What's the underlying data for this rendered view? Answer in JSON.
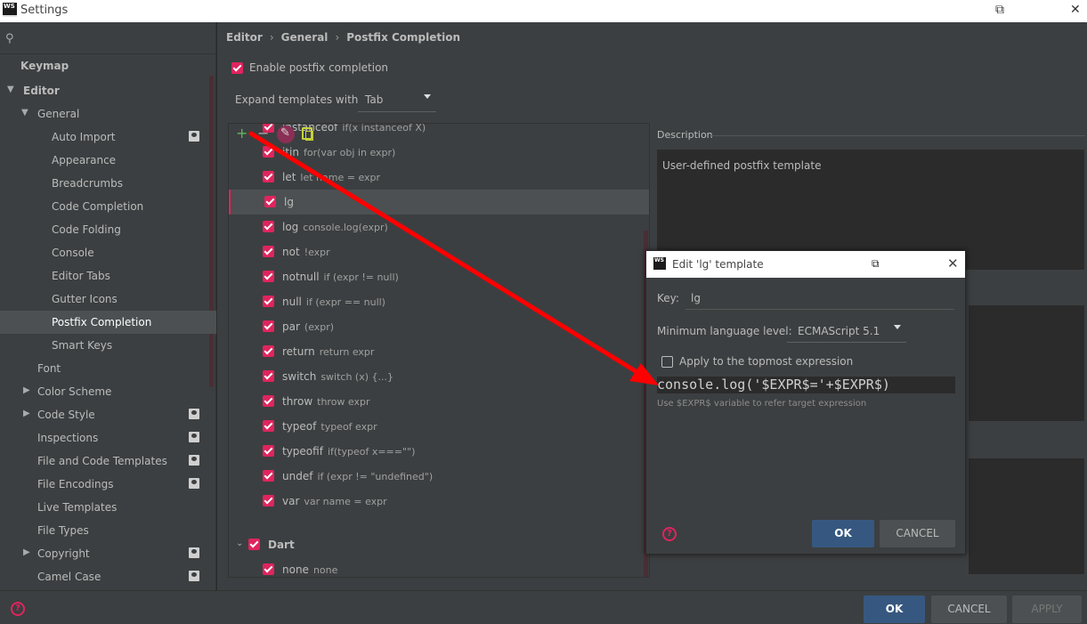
{
  "window": {
    "title": "Settings",
    "logo": "WS"
  },
  "sidebar": {
    "items": [
      {
        "label": "Keymap"
      },
      {
        "label": "Editor"
      },
      {
        "label": "General"
      },
      {
        "label": "Auto Import"
      },
      {
        "label": "Appearance"
      },
      {
        "label": "Breadcrumbs"
      },
      {
        "label": "Code Completion"
      },
      {
        "label": "Code Folding"
      },
      {
        "label": "Console"
      },
      {
        "label": "Editor Tabs"
      },
      {
        "label": "Gutter Icons"
      },
      {
        "label": "Postfix Completion"
      },
      {
        "label": "Smart Keys"
      },
      {
        "label": "Font"
      },
      {
        "label": "Color Scheme"
      },
      {
        "label": "Code Style"
      },
      {
        "label": "Inspections"
      },
      {
        "label": "File and Code Templates"
      },
      {
        "label": "File Encodings"
      },
      {
        "label": "Live Templates"
      },
      {
        "label": "File Types"
      },
      {
        "label": "Copyright"
      },
      {
        "label": "Camel Case"
      }
    ]
  },
  "breadcrumb": {
    "editor": "Editor",
    "general": "General",
    "current": "Postfix Completion",
    "sep": "›"
  },
  "settings": {
    "enable_label": "Enable postfix completion",
    "expand_label": "Expand templates with",
    "expand_value": "Tab"
  },
  "toolbar": {
    "add": "+",
    "remove": "−"
  },
  "templates": [
    {
      "key": "instanceof",
      "example": "if(x instanceof X)"
    },
    {
      "key": "itin",
      "example": "for(var obj in expr)"
    },
    {
      "key": "let",
      "example": "let name = expr"
    },
    {
      "key": "lg",
      "example": ""
    },
    {
      "key": "log",
      "example": "console.log(expr)"
    },
    {
      "key": "not",
      "example": "!expr"
    },
    {
      "key": "notnull",
      "example": "if (expr != null)"
    },
    {
      "key": "null",
      "example": "if (expr == null)"
    },
    {
      "key": "par",
      "example": "(expr)"
    },
    {
      "key": "return",
      "example": "return expr"
    },
    {
      "key": "switch",
      "example": "switch (x) {...}"
    },
    {
      "key": "throw",
      "example": "throw expr"
    },
    {
      "key": "typeof",
      "example": "typeof expr"
    },
    {
      "key": "typeofif",
      "example": "if(typeof x===\"\")"
    },
    {
      "key": "undef",
      "example": "if (expr != \"undefined\")"
    },
    {
      "key": "var",
      "example": "var name = expr"
    }
  ],
  "dart_group": {
    "label": "Dart",
    "template_key": "none",
    "template_example": "none"
  },
  "description": {
    "label": "Description",
    "text": "User-defined postfix template"
  },
  "dialog": {
    "title": "Edit 'lg' template",
    "key_label": "Key:",
    "key_value": "lg",
    "min_level_label": "Minimum language level:",
    "min_level_value": "ECMAScript 5.1",
    "topmost_label": "Apply to the topmost expression",
    "code": "console.log('$EXPR$='+$EXPR$)",
    "hint": "Use $EXPR$ variable to refer target expression",
    "ok": "OK",
    "cancel": "CANCEL",
    "help": "?"
  },
  "footer": {
    "ok": "OK",
    "cancel": "CANCEL",
    "apply": "APPLY",
    "help": "?"
  },
  "colors": {
    "accent": "#e0245e",
    "background": "#3c3f41",
    "ok_button": "#365880",
    "arrow": "#ff0000"
  }
}
